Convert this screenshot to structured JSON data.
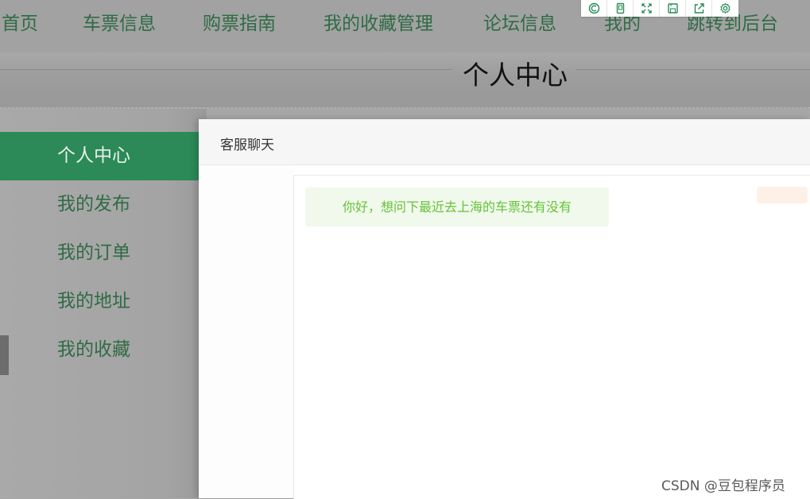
{
  "topnav": {
    "items": [
      {
        "label": "首页"
      },
      {
        "label": "车票信息"
      },
      {
        "label": "购票指南"
      },
      {
        "label": "我的收藏管理"
      },
      {
        "label": "论坛信息"
      },
      {
        "label": "我的"
      },
      {
        "label": "跳转到后台"
      }
    ]
  },
  "toolbar": {
    "icons": [
      "screenshot-icon",
      "phone-icon",
      "expand-icon",
      "save-icon",
      "share-icon",
      "settings-icon"
    ]
  },
  "page": {
    "title": "个人中心"
  },
  "sidebar": {
    "items": [
      {
        "label": "个人中心",
        "active": true
      },
      {
        "label": "我的发布"
      },
      {
        "label": "我的订单"
      },
      {
        "label": "我的地址"
      },
      {
        "label": "我的收藏"
      }
    ]
  },
  "dialog": {
    "title": "客服聊天",
    "messages": [
      {
        "text": "你好，想问下最近去上海的车票还有没有"
      }
    ]
  },
  "watermark": "CSDN @豆包程序员",
  "colors": {
    "accent": "#2b8a57",
    "nav_text": "#2f6b45",
    "message_text": "#67c23a",
    "message_bg": "#f0f9eb"
  }
}
